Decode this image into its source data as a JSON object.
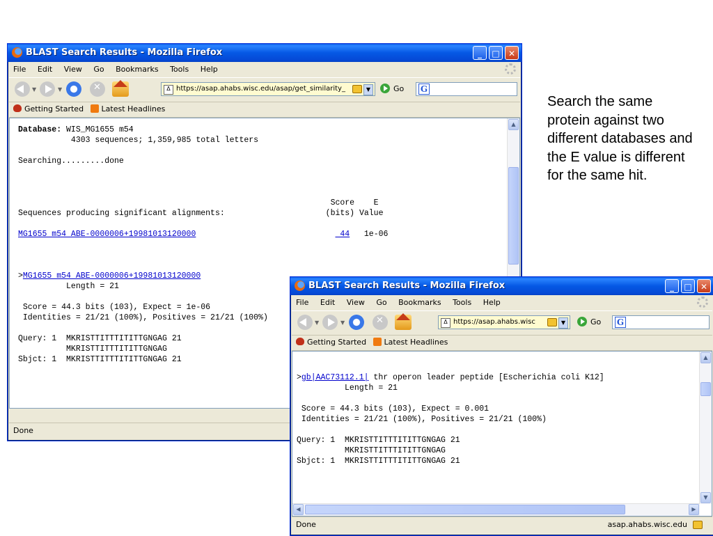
{
  "caption": "Search the same protein against two different databases and the E value is different for the same hit.",
  "window1": {
    "title": "BLAST Search Results - Mozilla Firefox",
    "menu": [
      "File",
      "Edit",
      "View",
      "Go",
      "Bookmarks",
      "Tools",
      "Help"
    ],
    "url": "https://asap.ahabs.wisc.edu/asap/get_similarity_",
    "go_label": "Go",
    "bookmarks": [
      "Getting Started",
      "Latest Headlines"
    ],
    "db_label": "Database:",
    "db_line1": " WIS_MG1655 m54",
    "db_line2": "           4303 sequences; 1,359,985 total letters",
    "searching": "Searching.........done",
    "col_head1": "                                                                 Score    E",
    "col_head2": "Sequences producing significant alignments:                     (bits) Value",
    "hit_link": "MG1655 m54 ABE-0000006+19981013120000",
    "hit_pad": "                             ",
    "hit_score": " 44",
    "hit_evalue": "   1e-06",
    "aln_prefix": ">",
    "aln_link": "MG1655 m54 ABE-0000006+19981013120000",
    "length": "          Length = 21",
    "score_line": " Score = 44.3 bits (103), Expect = 1e-06",
    "ident_line": " Identities = 21/21 (100%), Positives = 21/21 (100%)",
    "query": "Query: 1  MKRISTTITTTITITTGNGAG 21",
    "midline": "          MKRISTTITTTITITTGNGAG",
    "sbjct": "Sbjct: 1  MKRISTTITTTITITTGNGAG 21",
    "status": "Done"
  },
  "window2": {
    "title": "BLAST Search Results - Mozilla Firefox",
    "menu": [
      "File",
      "Edit",
      "View",
      "Go",
      "Bookmarks",
      "Tools",
      "Help"
    ],
    "url": "https://asap.ahabs.wisc",
    "go_label": "Go",
    "bookmarks": [
      "Getting Started",
      "Latest Headlines"
    ],
    "aln_prefix": ">",
    "aln_link": "gb|AAC73112.1|",
    "aln_desc": " thr operon leader peptide [Escherichia coli K12]",
    "length": "          Length = 21",
    "score_line": " Score = 44.3 bits (103), Expect = 0.001",
    "ident_line": " Identities = 21/21 (100%), Positives = 21/21 (100%)",
    "query": "Query: 1  MKRISTTITTTITITTGNGAG 21",
    "midline": "          MKRISTTITTTITITTGNGAG",
    "sbjct": "Sbjct: 1  MKRISTTITTTITITTGNGAG 21",
    "status": "Done",
    "status_host": "asap.ahabs.wisc.edu"
  }
}
